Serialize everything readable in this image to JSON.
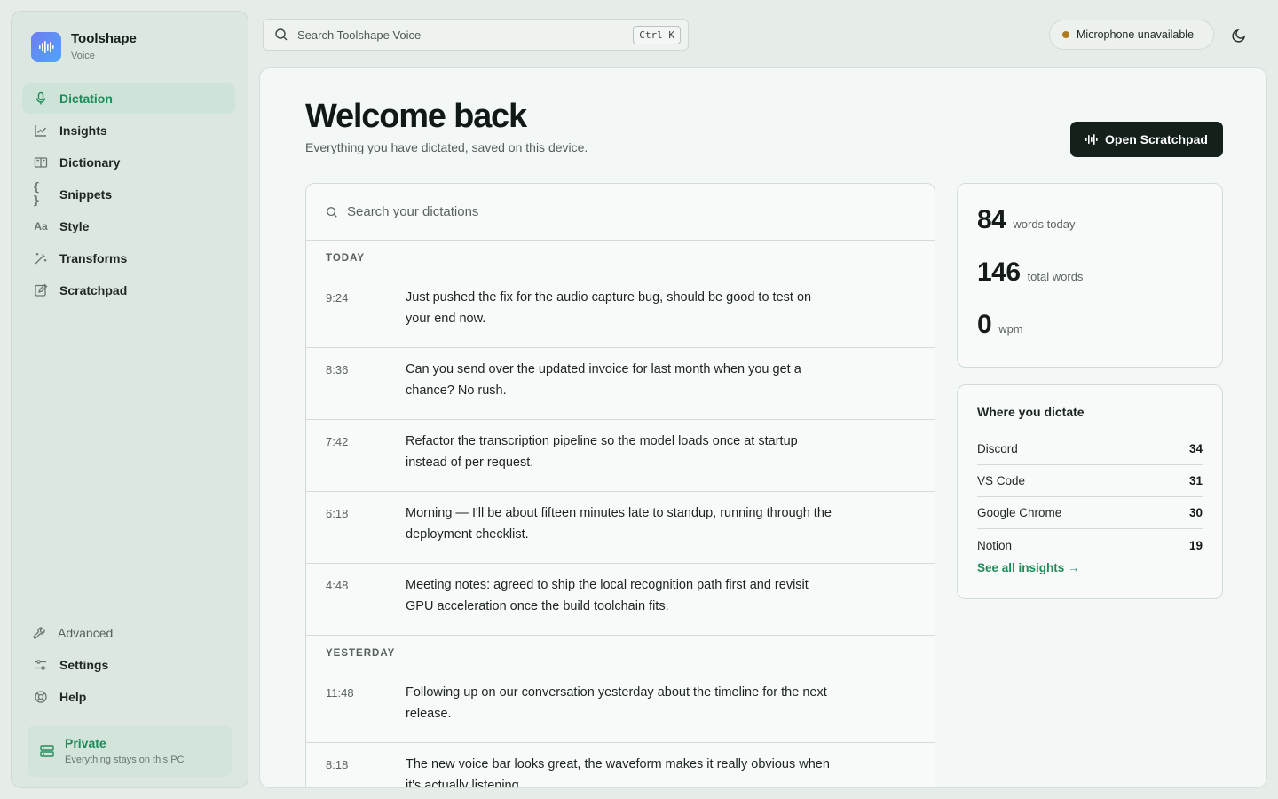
{
  "brand": {
    "name": "Toolshape",
    "sub": "Voice"
  },
  "nav": {
    "items": [
      {
        "label": "Dictation",
        "icon": "microphone-icon",
        "active": true
      },
      {
        "label": "Insights",
        "icon": "chart-line-icon"
      },
      {
        "label": "Dictionary",
        "icon": "book-icon"
      },
      {
        "label": "Snippets",
        "icon": "braces-icon"
      },
      {
        "label": "Style",
        "icon": "text-style-icon"
      },
      {
        "label": "Transforms",
        "icon": "magic-wand-icon"
      },
      {
        "label": "Scratchpad",
        "icon": "edit-note-icon"
      }
    ],
    "bottom": [
      {
        "label": "Advanced",
        "icon": "wrench-icon"
      },
      {
        "label": "Settings",
        "icon": "sliders-icon"
      },
      {
        "label": "Help",
        "icon": "lifebuoy-icon"
      }
    ]
  },
  "privacy": {
    "title": "Private",
    "subtitle": "Everything stays on this PC"
  },
  "topbar": {
    "search_placeholder": "Search Toolshape Voice",
    "shortcut": "Ctrl K",
    "mic_status": "Microphone unavailable",
    "status_color": "#b07a1e"
  },
  "main": {
    "title": "Welcome back",
    "subtitle": "Everything you have dictated, saved on this device.",
    "open_button": "Open Scratchpad",
    "search_placeholder": "Search your dictations"
  },
  "dictations": {
    "groups": [
      {
        "label": "TODAY",
        "entries": [
          {
            "time": "9:24",
            "text": "Just pushed the fix for the audio capture bug, should be good to test on your end now."
          },
          {
            "time": "8:36",
            "text": "Can you send over the updated invoice for last month when you get a chance? No rush."
          },
          {
            "time": "7:42",
            "text": "Refactor the transcription pipeline so the model loads once at startup instead of per request."
          },
          {
            "time": "6:18",
            "text": "Morning — I'll be about fifteen minutes late to standup, running through the deployment checklist."
          },
          {
            "time": "4:48",
            "text": "Meeting notes: agreed to ship the local recognition path first and revisit GPU acceleration once the build toolchain fits."
          }
        ]
      },
      {
        "label": "YESTERDAY",
        "entries": [
          {
            "time": "11:48",
            "text": "Following up on our conversation yesterday about the timeline for the next release."
          },
          {
            "time": "8:18",
            "text": "The new voice bar looks great, the waveform makes it really obvious when it's actually listening."
          }
        ]
      }
    ]
  },
  "stats": {
    "words_today": {
      "value": "84",
      "label": "words today"
    },
    "total_words": {
      "value": "146",
      "label": "total words"
    },
    "wpm": {
      "value": "0",
      "label": "wpm"
    }
  },
  "where": {
    "title": "Where you dictate",
    "apps": [
      {
        "name": "Discord",
        "count": "34"
      },
      {
        "name": "VS Code",
        "count": "31"
      },
      {
        "name": "Google Chrome",
        "count": "30"
      },
      {
        "name": "Notion",
        "count": "19"
      }
    ],
    "link": "See all insights →"
  },
  "colors": {
    "accent": "#1f8a5a",
    "dark_button": "#14201a",
    "background": "#e6ece8"
  }
}
